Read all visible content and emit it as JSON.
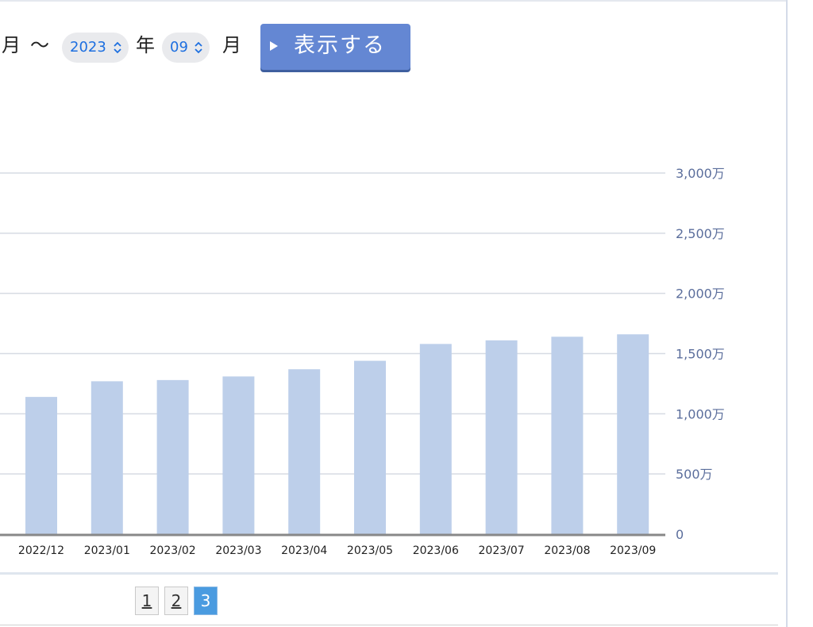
{
  "controls": {
    "month_suffix_start": "月",
    "range_sep": "〜",
    "year_value": "2023",
    "year_label": "年",
    "month_value": "09",
    "month_label": "月",
    "show_button": "表示する"
  },
  "pagination": {
    "pages": [
      "1",
      "2",
      "3"
    ],
    "active": "3"
  },
  "colors": {
    "bar": "#bdcfea",
    "axis_text": "#5b6e9c",
    "grid": "#d6dbe3",
    "baseline": "#888888",
    "button": "#6487d3",
    "active_page": "#4a9be0"
  },
  "chart_data": {
    "type": "bar",
    "categories": [
      "2022/12",
      "2023/01",
      "2023/02",
      "2023/03",
      "2023/04",
      "2023/05",
      "2023/06",
      "2023/07",
      "2023/08",
      "2023/09"
    ],
    "values": [
      1140,
      1270,
      1280,
      1310,
      1370,
      1440,
      1580,
      1610,
      1640,
      1660
    ],
    "ylim": [
      0,
      3000
    ],
    "yticks": [
      0,
      500,
      1000,
      1500,
      2000,
      2500,
      3000
    ],
    "ytick_labels": [
      "0",
      "500万",
      "1,000万",
      "1,500万",
      "2,000万",
      "2,500万",
      "3,000万"
    ],
    "y_axis_side": "right",
    "grid": true
  }
}
